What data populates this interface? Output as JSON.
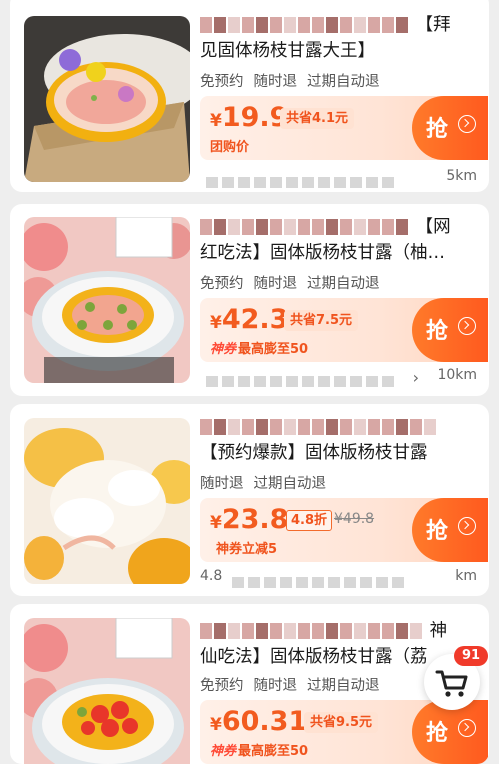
{
  "products": [
    {
      "title_line1_end": "【拜",
      "title_line2": "见固体杨枝甘露大王】",
      "tags": [
        "免预约",
        "随时退",
        "过期自动退"
      ],
      "currency": "¥",
      "price": "19.9",
      "save_text": "共省4.1元",
      "sub_text": "团购价",
      "grab_label": "抢",
      "distance": "5km"
    },
    {
      "title_line1_end": "【网",
      "title_line2": "红吃法】固体版杨枝甘露（柚…",
      "tags": [
        "免预约",
        "随时退",
        "过期自动退"
      ],
      "currency": "¥",
      "price": "42.3",
      "save_text": "共省7.5元",
      "coupon_tag": "神券",
      "sub_text": "最高膨至50",
      "grab_label": "抢",
      "distance": "10km"
    },
    {
      "title_line2": "【预约爆款】固体版杨枝甘露",
      "tags": [
        "随时退",
        "过期自动退"
      ],
      "currency": "¥",
      "price": "23.8",
      "discount": "4.8折",
      "original_price": "¥49.8",
      "sub_text": "神券立减5",
      "grab_label": "抢",
      "distance_prefix": "4.8",
      "distance": "km"
    },
    {
      "title_line1_end": "神",
      "title_line2": "仙吃法】固体版杨枝甘露（荔",
      "tags": [
        "免预约",
        "随时退",
        "过期自动退"
      ],
      "currency": "¥",
      "price": "60.31",
      "save_text": "共省9.5元",
      "coupon_tag": "神券",
      "sub_text": "最高膨至50",
      "grab_label": "抢"
    }
  ],
  "cart": {
    "count": "91"
  },
  "colors": {
    "accent": "#f25b1f",
    "button": "#ff5a1f"
  }
}
